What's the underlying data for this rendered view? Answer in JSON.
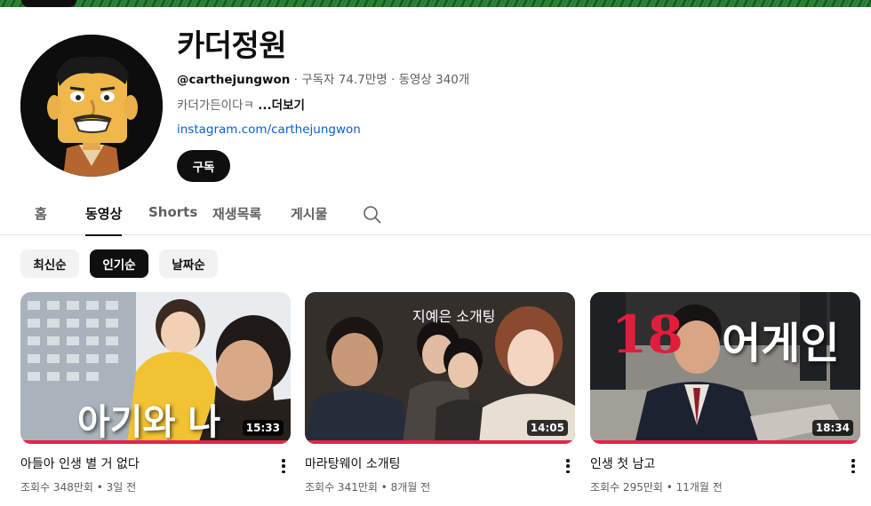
{
  "channel": {
    "name": "카더정원",
    "handle": "@carthejungwon",
    "meta": " · 구독자 74.7만명 · 동영상 340개",
    "description": "카더가든이다ㅋ ",
    "more": "...더보기",
    "link": "instagram.com/carthejungwon",
    "subscribe_label": "구독"
  },
  "tabs": [
    {
      "label": "홈"
    },
    {
      "label": "동영상"
    },
    {
      "label": "Shorts"
    },
    {
      "label": "재생목록"
    },
    {
      "label": "게시물"
    }
  ],
  "chips": [
    {
      "label": "최신순"
    },
    {
      "label": "인기순"
    },
    {
      "label": "날짜순"
    }
  ],
  "videos": [
    {
      "title": "아들아 인생 별 거 없다",
      "meta": "조회수 348만회 • 3일 전",
      "duration": "15:33",
      "overlay": "아기와 나"
    },
    {
      "title": "마라탕웨이 소개팅",
      "meta": "조회수 341만회 • 8개월 전",
      "duration": "14:05",
      "overlay": "지예은 소개팅"
    },
    {
      "title": "인생 첫 남고",
      "meta": "조회수 295만회 • 11개월 전",
      "duration": "18:34",
      "overlay_num": "18",
      "overlay": "어게인"
    }
  ],
  "colors": {
    "accent_progress": "#e4234b",
    "link": "#065fd4",
    "banner": "#2f8f3a"
  },
  "icons": {
    "search": "search-icon",
    "menu": "more-vert-icon"
  }
}
